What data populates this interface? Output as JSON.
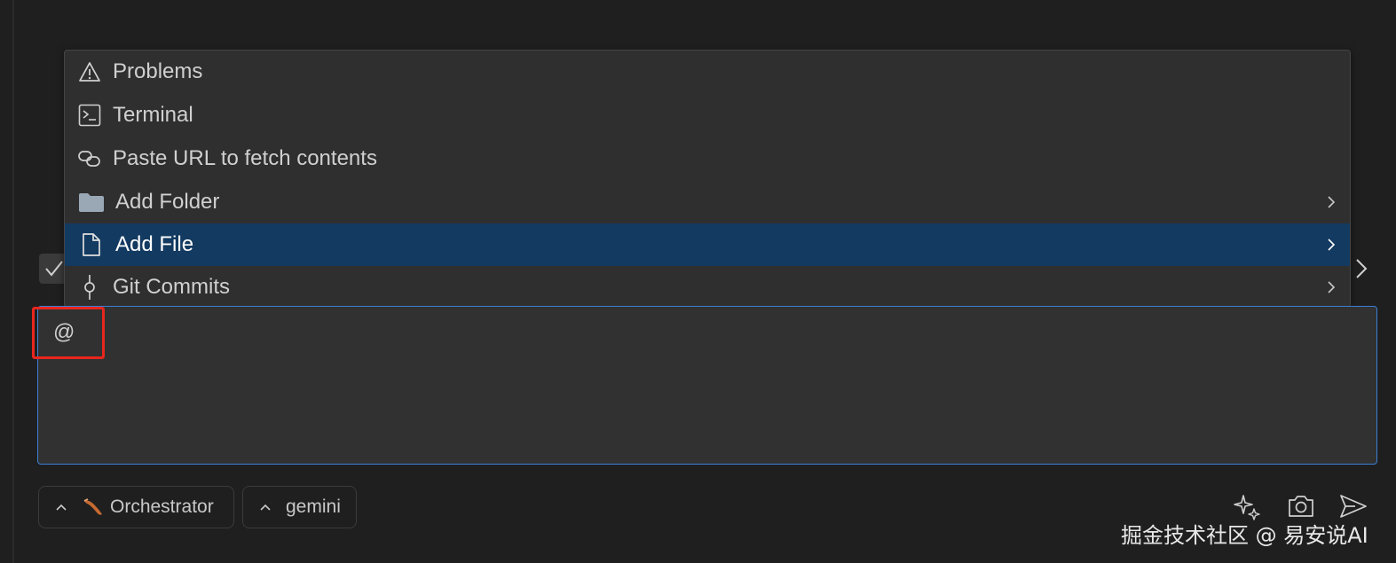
{
  "menu": {
    "items": [
      {
        "label": "Problems",
        "icon": "warning-icon",
        "submenu": false,
        "selected": false
      },
      {
        "label": "Terminal",
        "icon": "terminal-icon",
        "submenu": false,
        "selected": false
      },
      {
        "label": "Paste URL to fetch contents",
        "icon": "link-icon",
        "submenu": false,
        "selected": false
      },
      {
        "label": "Add Folder",
        "icon": "folder-icon",
        "submenu": true,
        "selected": false
      },
      {
        "label": "Add File",
        "icon": "file-icon",
        "submenu": true,
        "selected": true
      },
      {
        "label": "Git Commits",
        "icon": "git-commit-icon",
        "submenu": true,
        "selected": false
      }
    ]
  },
  "input": {
    "value": "@"
  },
  "bottom_bar": {
    "mode_label": "Orchestrator",
    "model_label": "gemini"
  },
  "watermark": "掘金技术社区 @ 易安说AI",
  "colors": {
    "accent": "#3b7fd4",
    "selected_bg": "#133a60",
    "highlight_red": "#e8261e"
  }
}
